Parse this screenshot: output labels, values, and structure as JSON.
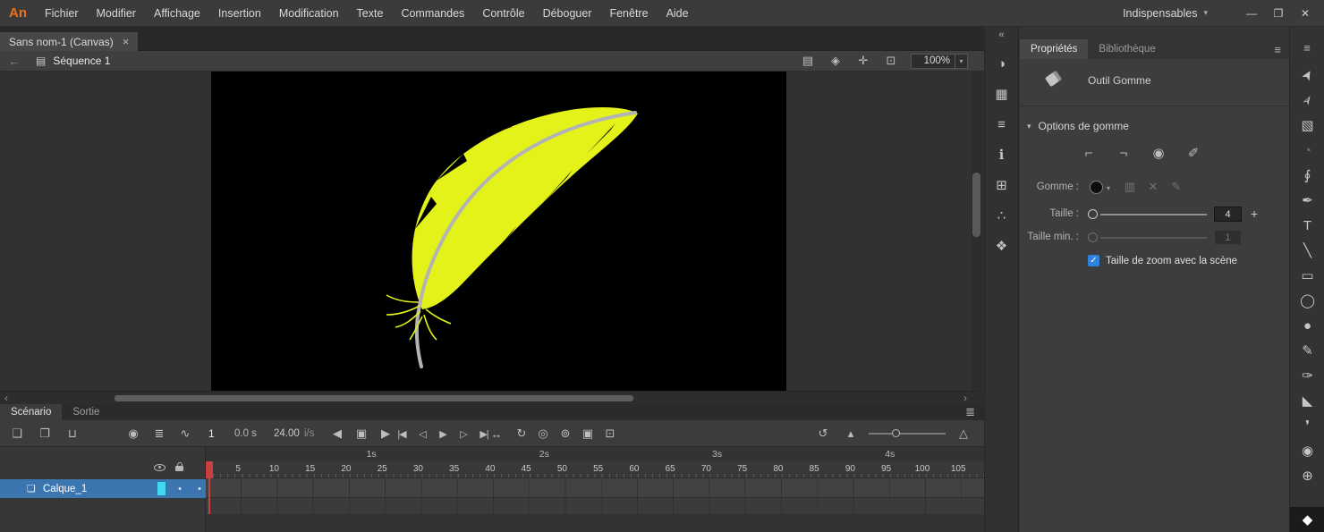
{
  "app": {
    "logo_text": "An",
    "workspace_label": "Indispensables",
    "workspace_caret": "▾"
  },
  "menu_items": [
    {
      "name": "menu-fichier",
      "label": "Fichier"
    },
    {
      "name": "menu-modifier",
      "label": "Modifier"
    },
    {
      "name": "menu-affichage",
      "label": "Affichage"
    },
    {
      "name": "menu-insertion",
      "label": "Insertion"
    },
    {
      "name": "menu-modification",
      "label": "Modification"
    },
    {
      "name": "menu-texte",
      "label": "Texte"
    },
    {
      "name": "menu-commandes",
      "label": "Commandes"
    },
    {
      "name": "menu-controle",
      "label": "Contrôle"
    },
    {
      "name": "menu-deboguer",
      "label": "Déboguer"
    },
    {
      "name": "menu-fenetre",
      "label": "Fenêtre"
    },
    {
      "name": "menu-aide",
      "label": "Aide"
    }
  ],
  "window_controls": [
    {
      "name": "minimize-button",
      "glyph": "—"
    },
    {
      "name": "maximize-button",
      "glyph": "❐"
    },
    {
      "name": "close-button",
      "glyph": "✕"
    }
  ],
  "document_tab": {
    "title": "Sans nom-1 (Canvas)",
    "close_glyph": "×"
  },
  "scene_bar": {
    "back_glyph": "←",
    "scene_icon_glyph": "▤",
    "scene_name": "Séquence 1",
    "right_icons": [
      {
        "name": "edit-scene-icon",
        "glyph": "▤"
      },
      {
        "name": "edit-symbols-icon",
        "glyph": "◈"
      },
      {
        "name": "center-stage-icon",
        "glyph": "✛"
      },
      {
        "name": "clip-content-icon",
        "glyph": "⊡"
      }
    ],
    "zoom_value": "100%",
    "zoom_caret": "▾"
  },
  "canvas": {
    "stage_color": "#000000",
    "feather_color": "#e3f319",
    "stem_color": "#b3b3b3"
  },
  "timeline": {
    "tabs": [
      {
        "name": "tab-scenario",
        "label": "Scénario",
        "active": true
      },
      {
        "name": "tab-sortie",
        "label": "Sortie",
        "active": false
      }
    ],
    "menu_glyph": "≣",
    "toolbar": {
      "layer_icons": [
        {
          "name": "new-layer-icon",
          "glyph": "❏"
        },
        {
          "name": "new-folder-icon",
          "glyph": "❐"
        },
        {
          "name": "delete-layer-icon",
          "glyph": "⊔"
        }
      ],
      "view_icons": [
        {
          "name": "add-camera-icon",
          "glyph": "◉"
        },
        {
          "name": "layer-depth-icon",
          "glyph": "≣"
        },
        {
          "name": "graph-editor-icon",
          "glyph": "∿"
        }
      ],
      "current_frame": "1",
      "elapsed_time": "0.0 s",
      "fps_value": "24.00",
      "fps_unit": "i/s",
      "nav_icons": [
        {
          "name": "step-back-icon",
          "glyph": "◀"
        },
        {
          "name": "current-frame-icon",
          "glyph": "▣"
        },
        {
          "name": "step-forward-icon",
          "glyph": "▶"
        }
      ],
      "transport_icons": [
        {
          "name": "go-first-frame-icon",
          "glyph": "|◀"
        },
        {
          "name": "prev-frame-icon",
          "glyph": "◁"
        },
        {
          "name": "play-icon",
          "glyph": "▶"
        },
        {
          "name": "next-frame-icon",
          "glyph": "▷"
        },
        {
          "name": "go-last-frame-icon",
          "glyph": "▶|"
        }
      ],
      "loop_icons": [
        {
          "name": "insert-frames-icon",
          "glyph": "↔"
        },
        {
          "name": "loop-icon",
          "glyph": "↻"
        }
      ],
      "onion_icons": [
        {
          "name": "onion-skin-icon",
          "glyph": "◎"
        },
        {
          "name": "onion-outline-icon",
          "glyph": "⊚"
        },
        {
          "name": "edit-multiple-frames-icon",
          "glyph": "▣"
        },
        {
          "name": "marker-range-icon",
          "glyph": "⊡"
        }
      ],
      "right_icons": [
        {
          "name": "reset-timeline-zoom-icon",
          "glyph": "↺"
        },
        {
          "name": "shorten-frames-icon",
          "glyph": "▴"
        }
      ],
      "fit_glyph": "△"
    },
    "ruler": {
      "seconds": [
        {
          "label": "1s",
          "frame": 24
        },
        {
          "label": "2s",
          "frame": 48
        },
        {
          "label": "3s",
          "frame": 72
        },
        {
          "label": "4s",
          "frame": 96
        }
      ],
      "frames": [
        1,
        5,
        10,
        15,
        20,
        25,
        30,
        35,
        40,
        45,
        50,
        55,
        60,
        65,
        70,
        75,
        80,
        85,
        90,
        95,
        100,
        105
      ]
    },
    "layers": [
      {
        "name": "Calque_1",
        "selected": true
      }
    ]
  },
  "panel_strip": {
    "collapse_glyph": "«",
    "icons": [
      {
        "name": "color-panel-icon",
        "glyph": "◑"
      },
      {
        "name": "swatches-panel-icon",
        "glyph": "▦"
      },
      {
        "name": "align-panel-icon",
        "glyph": "≡"
      },
      {
        "name": "info-panel-icon",
        "glyph": "ℹ"
      },
      {
        "name": "transform-panel-icon",
        "glyph": "⊞"
      },
      {
        "name": "code-snippets-panel-icon",
        "glyph": "∴"
      },
      {
        "name": "history-panel-icon",
        "glyph": "❖"
      }
    ]
  },
  "properties": {
    "tabs": [
      {
        "name": "tab-proprietes",
        "label": "Propriétés",
        "active": true
      },
      {
        "name": "tab-bibliotheque",
        "label": "Bibliothèque",
        "active": false
      }
    ],
    "menu_glyph": "≡",
    "tool_title": "Outil Gomme",
    "options": {
      "caret": "▾",
      "title": "Options de gomme",
      "option_icons": [
        {
          "name": "faucet-icon",
          "glyph": "⌐"
        },
        {
          "name": "erase-fills-icon",
          "glyph": "¬"
        },
        {
          "name": "erase-lines-icon",
          "glyph": "◉"
        },
        {
          "name": "erase-selected-icon",
          "glyph": "✐"
        }
      ],
      "gomme_label": "Gomme :",
      "shape_caret": "▾",
      "brush_icons": [
        {
          "name": "manage-brush-icon",
          "glyph": "▥",
          "dim": true
        },
        {
          "name": "delete-brush-icon",
          "glyph": "✕",
          "dim": true
        },
        {
          "name": "edit-brush-icon",
          "glyph": "✎",
          "dim": true
        }
      ],
      "taille_label": "Taille :",
      "taille_value": "4",
      "plus_glyph": "+",
      "taille_min_label": "Taille min. :",
      "taille_min_value": "1",
      "checkbox_label": "Taille de zoom avec la scène",
      "check_glyph": "✓"
    }
  },
  "tools": {
    "menu_glyph": "≡",
    "items": [
      {
        "name": "selection-tool",
        "glyph": "➤",
        "cls": "rot"
      },
      {
        "name": "subselection-tool",
        "glyph": "➢",
        "cls": "rot"
      },
      {
        "name": "free-transform-tool",
        "glyph": "▧"
      },
      {
        "name": "gradient-transform-tool",
        "glyph": "◔",
        "dim": true
      },
      {
        "name": "lasso-tool",
        "glyph": "∮"
      },
      {
        "name": "pen-tool",
        "glyph": "✒"
      },
      {
        "name": "text-tool",
        "glyph": "T"
      },
      {
        "name": "line-tool",
        "glyph": "╲"
      },
      {
        "name": "rectangle-tool",
        "glyph": "▭"
      },
      {
        "name": "oval-tool",
        "glyph": "◯"
      },
      {
        "name": "fluid-brush-tool",
        "glyph": "●"
      },
      {
        "name": "pencil-tool",
        "glyph": "✎"
      },
      {
        "name": "classic-brush-tool",
        "glyph": "✑"
      },
      {
        "name": "paint-bucket-tool",
        "glyph": "◣"
      },
      {
        "name": "eyedropper-tool",
        "glyph": "❜"
      },
      {
        "name": "camera-tool",
        "glyph": "◉"
      },
      {
        "name": "zoom-tool",
        "glyph": "⊕"
      },
      {
        "name": "eraser-tool",
        "glyph": "◆",
        "selected": true
      }
    ]
  }
}
